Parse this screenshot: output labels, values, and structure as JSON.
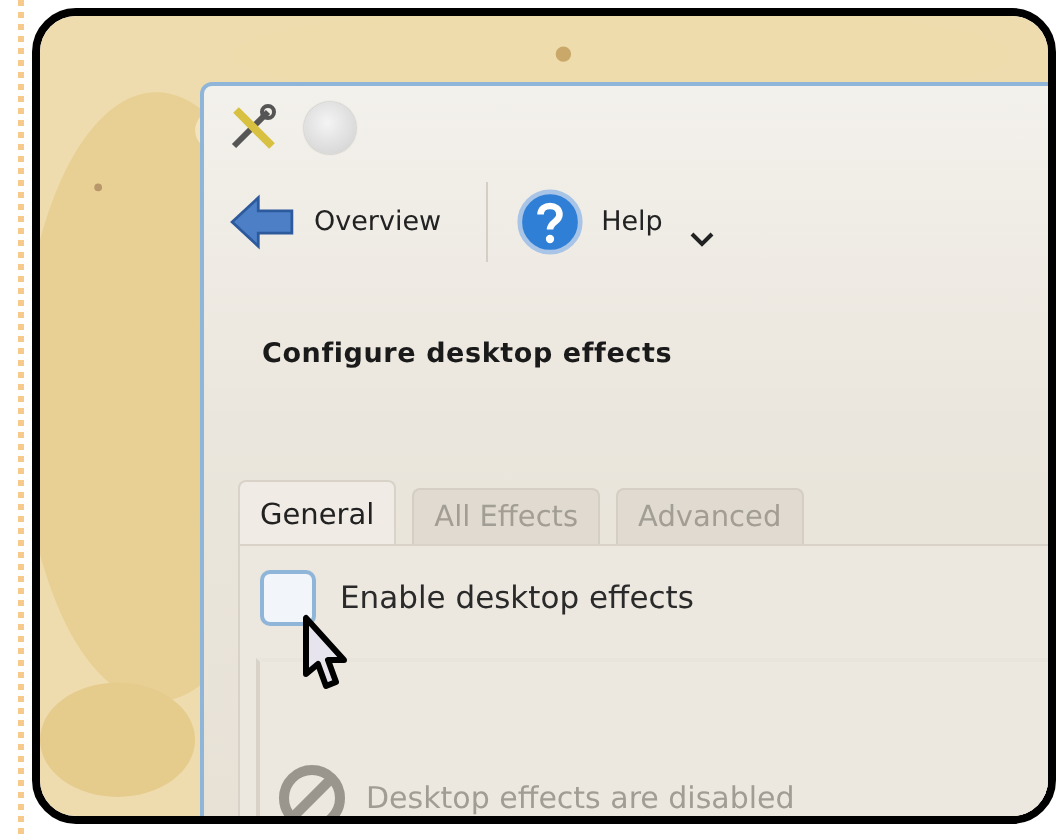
{
  "toolbar": [
    {
      "label": "Overview",
      "kind": "back"
    },
    {
      "label": "Help",
      "kind": "help",
      "menu": true
    }
  ],
  "heading": "Configure desktop effects",
  "tabs": [
    {
      "label": "General",
      "selected": true
    },
    {
      "label": "All Effects",
      "selected": false
    },
    {
      "label": "Advanced",
      "selected": false
    }
  ],
  "enable_checkbox": {
    "label": "Enable desktop effects",
    "checked": false
  },
  "status": {
    "text": "Desktop effects are disabled",
    "disabled": true
  }
}
